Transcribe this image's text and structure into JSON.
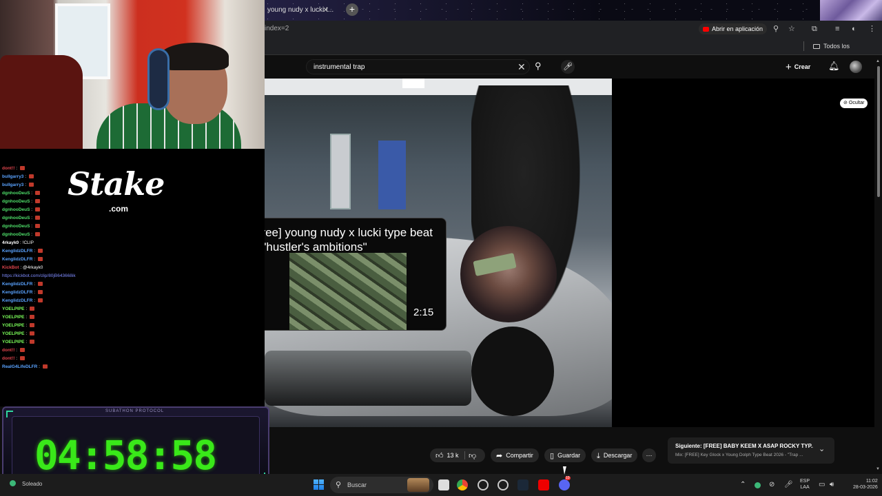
{
  "browser": {
    "tab_title": "young nudy x lucki t...",
    "url_fragment": "index=2",
    "open_in_app": "Abrir en aplicación",
    "bookmarks_all": "Todos los marcadores"
  },
  "youtube": {
    "search_query": "instrumental trap",
    "create_label": "Crear",
    "hide_label": "Ocultar",
    "endcard": {
      "title": "[free] young nudy x lucki type beat - \"hustler's ambitions\"",
      "duration": "2:15"
    },
    "actions": {
      "like_count": "13 k",
      "share": "Compartir",
      "save": "Guardar",
      "download": "Descargar"
    },
    "next": {
      "label": "Siguiente: [FREE] BABY KEEM X ASAP ROCKY TYP...",
      "sub": "Mix: [FREE] Key Glock x Young Dolph Type Beat 2026 - \"Trap ..."
    }
  },
  "overlay": {
    "chat": [
      {
        "user": "dont!!",
        "text": "",
        "color": "#e0454d"
      },
      {
        "user": "bullgarry3",
        "text": "",
        "color": "#5aa3ff"
      },
      {
        "user": "bullgarry3",
        "text": "",
        "color": "#5aa3ff"
      },
      {
        "user": "dgnhooDeuS",
        "text": "",
        "color": "#4fe06a"
      },
      {
        "user": "dgnhooDeuS",
        "text": "",
        "color": "#4fe06a"
      },
      {
        "user": "dgnhooDeuS",
        "text": "",
        "color": "#4fe06a"
      },
      {
        "user": "dgnhooDeuS",
        "text": "",
        "color": "#4fe06a"
      },
      {
        "user": "dgnhooDeuS",
        "text": "",
        "color": "#4fe06a"
      },
      {
        "user": "dgnhooDeuS",
        "text": "",
        "color": "#4fe06a"
      },
      {
        "user": "4rkayk0",
        "text": "!CLIP",
        "color": "#ffffff"
      },
      {
        "user": "KenglidzDLFR",
        "text": "",
        "color": "#5aa3ff"
      },
      {
        "user": "KenglidzDLFR",
        "text": "",
        "color": "#5aa3ff"
      },
      {
        "user": "KickBot",
        "text": "@4rkayk0",
        "color": "#e0454d"
      },
      {
        "user": "",
        "text": "https://kickbot.com/clip/80jB643668ik",
        "color": "#7f8cff"
      },
      {
        "user": "KenglidzDLFR",
        "text": "",
        "color": "#5aa3ff"
      },
      {
        "user": "KenglidzDLFR",
        "text": "",
        "color": "#5aa3ff"
      },
      {
        "user": "KenglidzDLFR",
        "text": "",
        "color": "#5aa3ff"
      },
      {
        "user": "YOELPIPE",
        "text": "",
        "color": "#7cff5a"
      },
      {
        "user": "YOELPIPE",
        "text": "",
        "color": "#7cff5a"
      },
      {
        "user": "YOELPIPE",
        "text": "",
        "color": "#7cff5a"
      },
      {
        "user": "YOELPIPE",
        "text": "",
        "color": "#7cff5a"
      },
      {
        "user": "YOELPIPE",
        "text": "",
        "color": "#7cff5a"
      },
      {
        "user": "dont!!",
        "text": "",
        "color": "#e0454d"
      },
      {
        "user": "dont!!",
        "text": "",
        "color": "#e0454d"
      },
      {
        "user": "RealG4LifeDLFR",
        "text": "",
        "color": "#5aa3ff"
      }
    ],
    "sponsor_name": "Stake",
    "sponsor_tld": ".com",
    "timer_label": "SUBATHON PROTOCOL",
    "timer": "04:58:58"
  },
  "taskbar": {
    "weather": "Soleado",
    "search": "Buscar",
    "lang_1": "ESP",
    "lang_2": "LAA",
    "time": "11:02",
    "date": "28-03-2026",
    "badge_count": "10"
  }
}
